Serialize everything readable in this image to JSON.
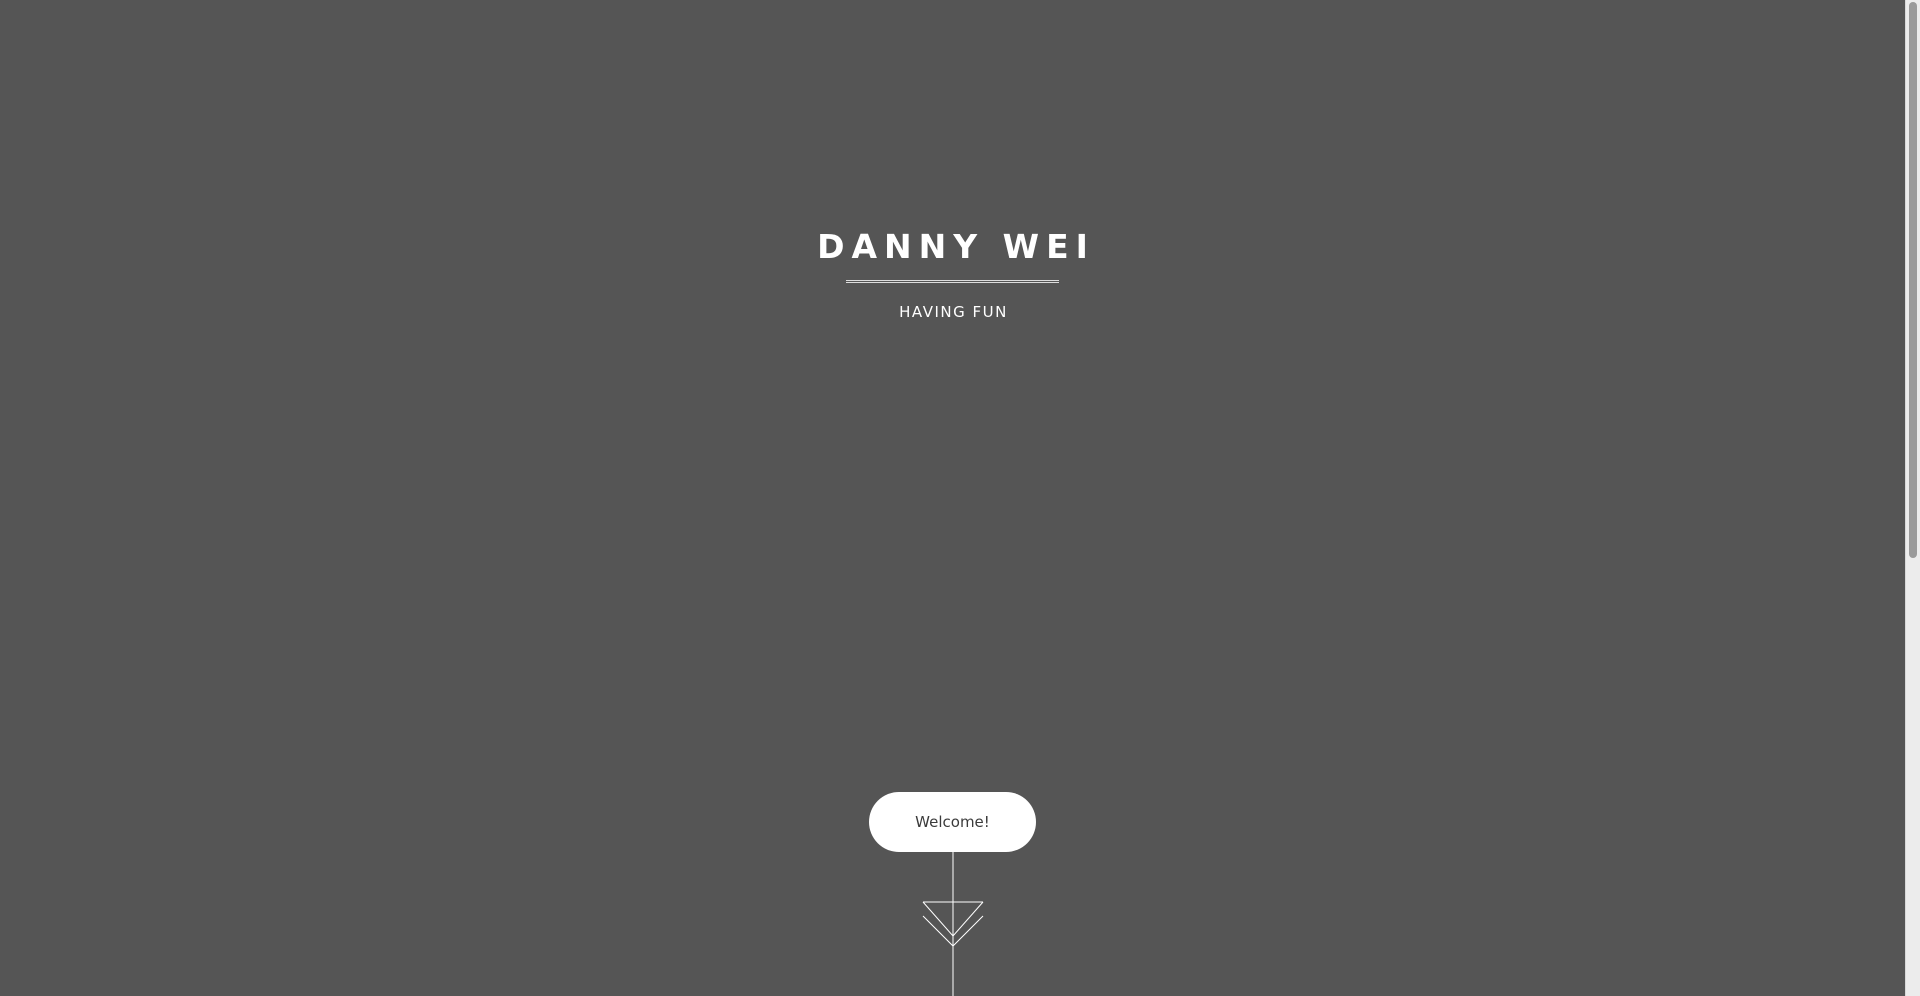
{
  "hero": {
    "title": "DANNY WEI",
    "subtitle": "HAVING FUN"
  },
  "cta": {
    "label": "Welcome!"
  },
  "colors": {
    "background": "#555555",
    "text": "#ffffff",
    "button_bg": "#ffffff",
    "button_text": "#3b3b3b"
  },
  "icons": {
    "scroll_indicator": "down-arrow-lines-icon"
  }
}
